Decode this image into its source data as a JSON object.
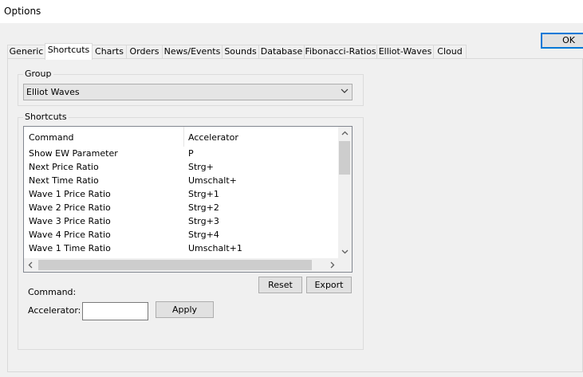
{
  "window": {
    "title": "Options"
  },
  "ok_label": "OK",
  "tabs": [
    "Generic",
    "Shortcuts",
    "Charts",
    "Orders",
    "News/Events",
    "Sounds",
    "Database",
    "Fibonacci-Ratios",
    "Elliot-Waves",
    "Cloud"
  ],
  "active_tab": "Shortcuts",
  "group": {
    "legend": "Group",
    "selected": "Elliot Waves"
  },
  "shortcuts": {
    "legend": "Shortcuts",
    "columns": {
      "command": "Command",
      "accelerator": "Accelerator"
    },
    "rows": [
      {
        "command": "Show EW Parameter",
        "accelerator": "P"
      },
      {
        "command": "Next Price Ratio",
        "accelerator": "Strg+"
      },
      {
        "command": "Next Time Ratio",
        "accelerator": "Umschalt+"
      },
      {
        "command": "Wave 1 Price Ratio",
        "accelerator": "Strg+1"
      },
      {
        "command": "Wave 2 Price Ratio",
        "accelerator": "Strg+2"
      },
      {
        "command": "Wave 3 Price Ratio",
        "accelerator": "Strg+3"
      },
      {
        "command": "Wave 4 Price Ratio",
        "accelerator": "Strg+4"
      },
      {
        "command": "Wave 1 Time Ratio",
        "accelerator": "Umschalt+1"
      }
    ],
    "reset_label": "Reset",
    "export_label": "Export",
    "command_label": "Command:",
    "accelerator_label": "Accelerator:",
    "accelerator_value": "",
    "apply_label": "Apply"
  }
}
